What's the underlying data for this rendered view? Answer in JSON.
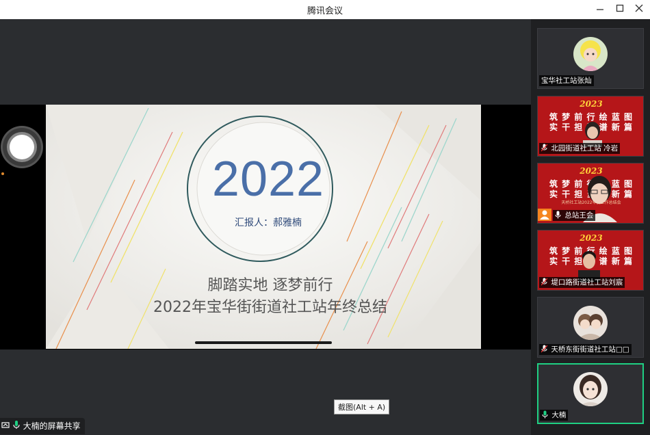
{
  "window": {
    "title": "腾讯会议",
    "controls": [
      "minimize",
      "maximize",
      "close"
    ]
  },
  "slide": {
    "year": "2022",
    "reporter": "汇报人：郝雅楠",
    "line1": "脚踏实地  逐梦前行",
    "line2": "2022年宝华街街道社工站年终总结"
  },
  "tooltip": "截图(Alt + A)",
  "screen_share_label": "大楠的屏幕共享",
  "banner": {
    "year": "2023",
    "line1": "筑 梦 前 行 绘 蓝 图",
    "line2": "实 干 担 当 谱 新 篇",
    "line3": "天桥社工站2022年度工作总结会"
  },
  "participants": [
    {
      "name": "宝华社工站张灿",
      "mic": false,
      "background": "dark"
    },
    {
      "name": "北园街道社工站 冷岩",
      "mic": true,
      "muted": true,
      "background": "banner"
    },
    {
      "name": "总站王会",
      "mic": true,
      "muted": false,
      "background": "banner",
      "host_icon": true
    },
    {
      "name": "堤口路街道社工站刘宸",
      "mic": true,
      "muted": true,
      "background": "banner"
    },
    {
      "name": "天桥东街街道社工站□□",
      "mic": true,
      "muted": true,
      "background": "dark"
    },
    {
      "name": "大楠",
      "mic": true,
      "muted": false,
      "background": "dark",
      "active_speaker": true
    }
  ],
  "colors": {
    "accent_green": "#1fd083",
    "banner_red": "#b51619",
    "year_blue": "#4a6fa8"
  }
}
